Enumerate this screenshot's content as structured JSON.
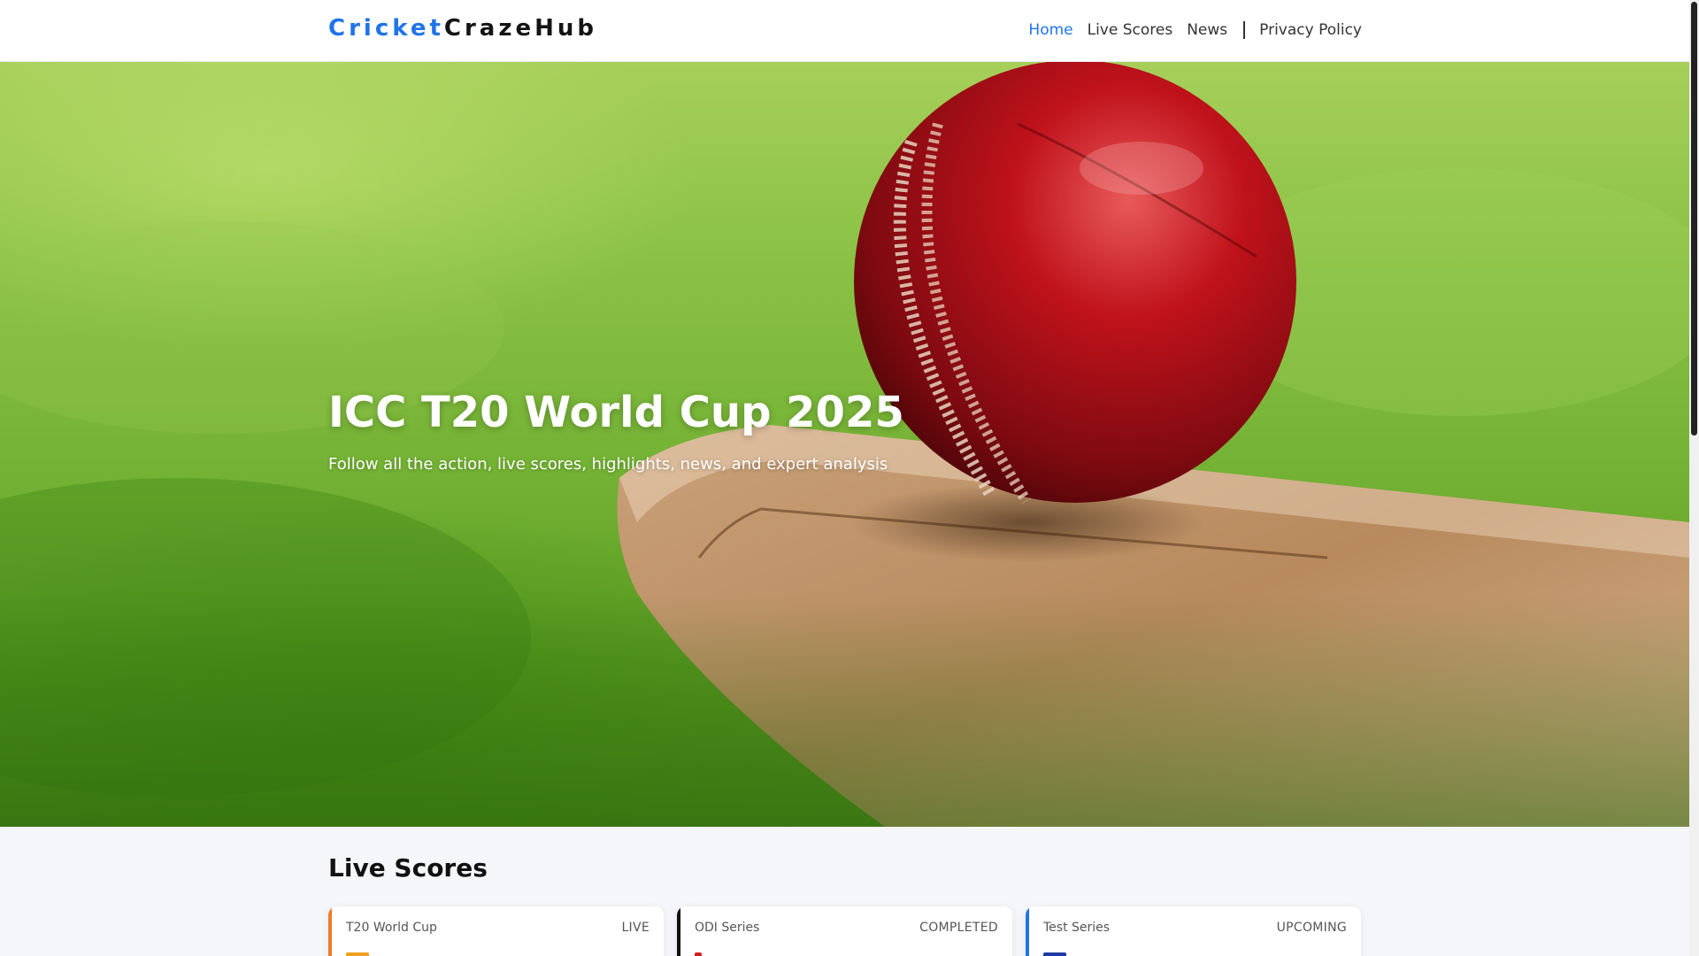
{
  "header": {
    "logo_part1": "Cricket",
    "logo_part2": "CrazeHub",
    "nav": {
      "home": "Home",
      "live_scores": "Live Scores",
      "news": "News",
      "privacy": "Privacy Policy"
    }
  },
  "hero": {
    "title": "ICC T20 World Cup 2025",
    "subtitle": "Follow all the action, live scores, highlights, news, and expert analysis"
  },
  "live_scores": {
    "title": "Live Scores",
    "cards": [
      {
        "series": "T20 World Cup",
        "status": "LIVE",
        "accent": "#f07a2a",
        "flag": "#f0a020"
      },
      {
        "series": "ODI Series",
        "status": "COMPLETED",
        "accent": "#111111",
        "flag": "#d32020"
      },
      {
        "series": "Test Series",
        "status": "UPCOMING",
        "accent": "#1f74e8",
        "flag": "#1f3aa0"
      }
    ]
  },
  "colors": {
    "brand": "#1f74e8",
    "dark": "#141414"
  }
}
